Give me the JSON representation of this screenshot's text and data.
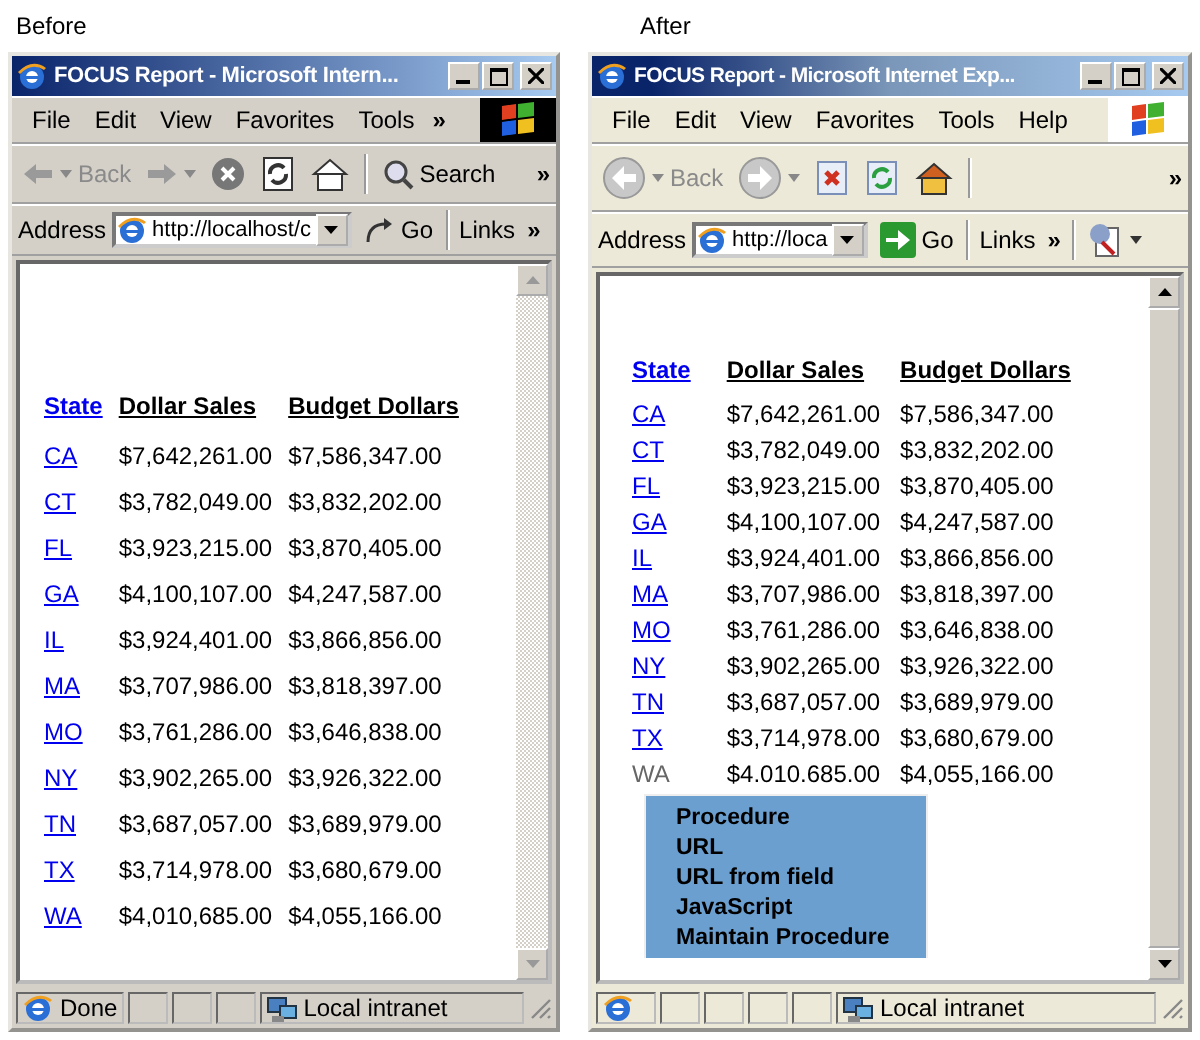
{
  "panels": [
    {
      "caption": "Before",
      "window": {
        "kind": "classic",
        "title": "FOCUS Report - Microsoft Intern...",
        "menu": [
          "File",
          "Edit",
          "View",
          "Favorites",
          "Tools"
        ],
        "menu_chevron": "»",
        "toolbar": {
          "buttons": [
            {
              "kind": "back",
              "label": "Back",
              "disabled": true
            },
            {
              "kind": "forward",
              "disabled": true
            },
            {
              "kind": "stop"
            },
            {
              "kind": "refresh"
            },
            {
              "kind": "home"
            },
            {
              "kind": "search",
              "label": "Search"
            }
          ],
          "chevron": "»"
        },
        "address": {
          "label": "Address",
          "value": "http://localhost/c",
          "go": "Go",
          "links": "Links",
          "links_chevron": "»"
        },
        "table": {
          "columns": [
            {
              "label": "State",
              "link": true
            },
            {
              "label": "Dollar Sales",
              "link": false
            },
            {
              "label": "Budget Dollars",
              "link": false
            }
          ],
          "rows": [
            {
              "state": "CA",
              "dollar_sales": "$7,642,261.00",
              "budget_dollars": "$7,586,347.00",
              "linked": true
            },
            {
              "state": "CT",
              "dollar_sales": "$3,782,049.00",
              "budget_dollars": "$3,832,202.00",
              "linked": true
            },
            {
              "state": "FL",
              "dollar_sales": "$3,923,215.00",
              "budget_dollars": "$3,870,405.00",
              "linked": true
            },
            {
              "state": "GA",
              "dollar_sales": "$4,100,107.00",
              "budget_dollars": "$4,247,587.00",
              "linked": true
            },
            {
              "state": "IL",
              "dollar_sales": "$3,924,401.00",
              "budget_dollars": "$3,866,856.00",
              "linked": true
            },
            {
              "state": "MA",
              "dollar_sales": "$3,707,986.00",
              "budget_dollars": "$3,818,397.00",
              "linked": true
            },
            {
              "state": "MO",
              "dollar_sales": "$3,761,286.00",
              "budget_dollars": "$3,646,838.00",
              "linked": true
            },
            {
              "state": "NY",
              "dollar_sales": "$3,902,265.00",
              "budget_dollars": "$3,926,322.00",
              "linked": true
            },
            {
              "state": "TN",
              "dollar_sales": "$3,687,057.00",
              "budget_dollars": "$3,689,979.00",
              "linked": true
            },
            {
              "state": "TX",
              "dollar_sales": "$3,714,978.00",
              "budget_dollars": "$3,680,679.00",
              "linked": true
            },
            {
              "state": "WA",
              "dollar_sales": "$4,010,685.00",
              "budget_dollars": "$4,055,166.00",
              "linked": true
            }
          ]
        },
        "status": {
          "text": "Done",
          "zone": "Local intranet"
        }
      }
    },
    {
      "caption": "After",
      "window": {
        "kind": "xp",
        "title": "FOCUS Report - Microsoft Internet Exp...",
        "menu": [
          "File",
          "Edit",
          "View",
          "Favorites",
          "Tools",
          "Help"
        ],
        "toolbar": {
          "buttons": [
            {
              "kind": "back",
              "label": "Back",
              "disabled": true
            },
            {
              "kind": "forward",
              "disabled": true
            },
            {
              "kind": "stop"
            },
            {
              "kind": "refresh"
            },
            {
              "kind": "home"
            }
          ],
          "chevron": "»"
        },
        "address": {
          "label": "Address",
          "value": "http://loca",
          "go": "Go",
          "links": "Links",
          "links_chevron": "»",
          "extra_tool": true
        },
        "table": {
          "columns": [
            {
              "label": "State",
              "link": true
            },
            {
              "label": "Dollar Sales",
              "link": false
            },
            {
              "label": "Budget Dollars",
              "link": false
            }
          ],
          "rows": [
            {
              "state": "CA",
              "dollar_sales": "$7,642,261.00",
              "budget_dollars": "$7,586,347.00",
              "linked": true
            },
            {
              "state": "CT",
              "dollar_sales": "$3,782,049.00",
              "budget_dollars": "$3,832,202.00",
              "linked": true
            },
            {
              "state": "FL",
              "dollar_sales": "$3,923,215.00",
              "budget_dollars": "$3,870,405.00",
              "linked": true
            },
            {
              "state": "GA",
              "dollar_sales": "$4,100,107.00",
              "budget_dollars": "$4,247,587.00",
              "linked": true
            },
            {
              "state": "IL",
              "dollar_sales": "$3,924,401.00",
              "budget_dollars": "$3,866,856.00",
              "linked": true
            },
            {
              "state": "MA",
              "dollar_sales": "$3,707,986.00",
              "budget_dollars": "$3,818,397.00",
              "linked": true
            },
            {
              "state": "MO",
              "dollar_sales": "$3,761,286.00",
              "budget_dollars": "$3,646,838.00",
              "linked": true
            },
            {
              "state": "NY",
              "dollar_sales": "$3,902,265.00",
              "budget_dollars": "$3,926,322.00",
              "linked": true
            },
            {
              "state": "TN",
              "dollar_sales": "$3,687,057.00",
              "budget_dollars": "$3,689,979.00",
              "linked": true
            },
            {
              "state": "TX",
              "dollar_sales": "$3,714,978.00",
              "budget_dollars": "$3,680,679.00",
              "linked": true
            },
            {
              "state": "WA",
              "dollar_sales": "$4.010.685.00",
              "budget_dollars": "$4,055,166.00",
              "linked": false
            }
          ]
        },
        "popup_menu": {
          "items": [
            "Procedure",
            "URL",
            "URL from field",
            "JavaScript",
            "Maintain Procedure"
          ]
        },
        "status": {
          "zone": "Local intranet"
        }
      }
    }
  ]
}
